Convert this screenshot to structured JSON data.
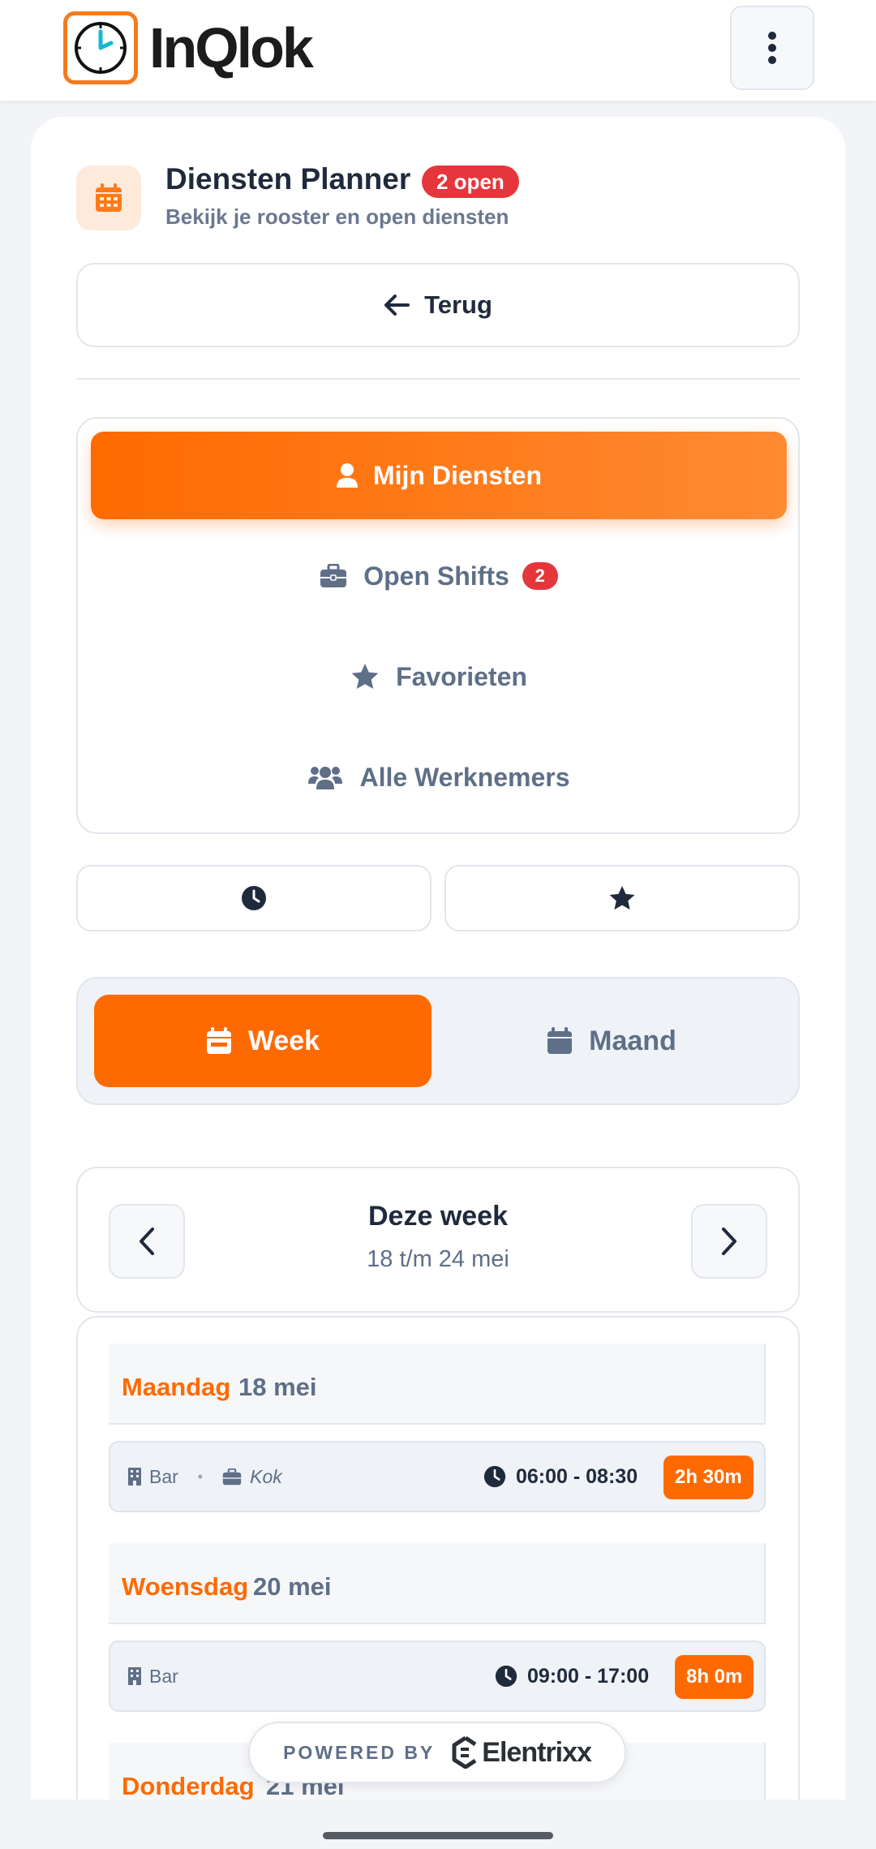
{
  "app": {
    "logo_text": "InQlok",
    "accent_color": "#ff6a00",
    "badge_color": "#e5363c"
  },
  "header": {
    "menu_icon": "more-vertical-icon"
  },
  "page": {
    "icon": "calendar-icon",
    "title": "Diensten Planner",
    "badge": "2 open",
    "subtitle": "Bekijk je rooster en open diensten",
    "back_label": "Terug"
  },
  "nav": {
    "items": [
      {
        "label": "Mijn Diensten",
        "icon": "user-icon",
        "active": true
      },
      {
        "label": "Open Shifts",
        "icon": "briefcase-icon",
        "badge": "2"
      },
      {
        "label": "Favorieten",
        "icon": "star-icon"
      },
      {
        "label": "Alle Werknemers",
        "icon": "users-icon"
      }
    ]
  },
  "quick_buttons": [
    {
      "icon": "clock-icon"
    },
    {
      "icon": "star-icon"
    }
  ],
  "view": {
    "week_label": "Week",
    "month_label": "Maand",
    "selected": "Week"
  },
  "week": {
    "title": "Deze week",
    "range": "18 t/m 24 mei"
  },
  "days": [
    {
      "name": "Maandag",
      "date": "18 mei",
      "shifts": [
        {
          "location": "Bar",
          "role": "Kok",
          "time": "06:00 - 08:30",
          "duration": "2h 30m"
        }
      ]
    },
    {
      "name": "Woensdag",
      "date": "20 mei",
      "shifts": [
        {
          "location": "Bar",
          "time": "09:00 - 17:00",
          "duration": "8h 0m"
        }
      ]
    },
    {
      "name": "Donderdag",
      "date": "21 mei",
      "shifts": []
    }
  ],
  "footer": {
    "powered_label": "POWERED BY",
    "brand": "Elentrixx"
  }
}
